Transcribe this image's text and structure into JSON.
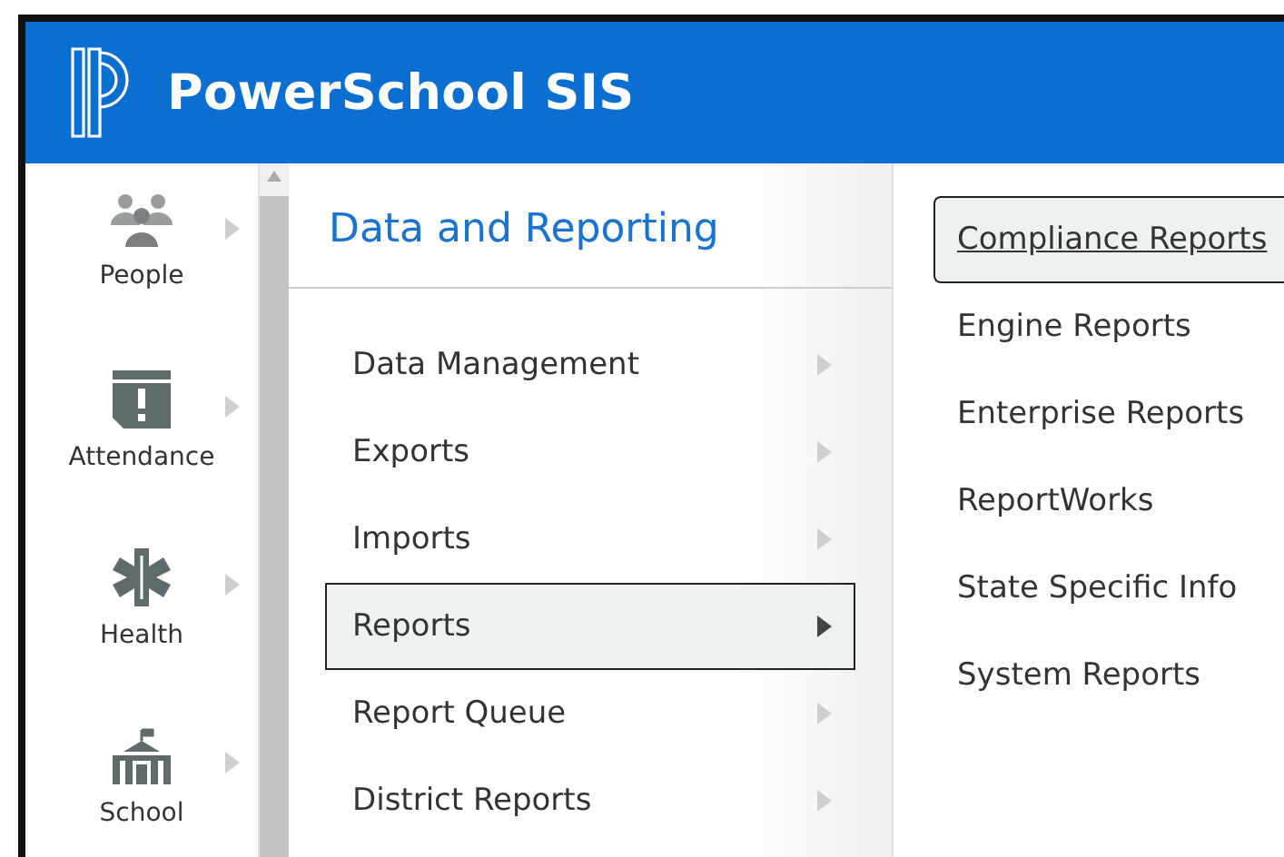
{
  "header": {
    "title": "PowerSchool SIS"
  },
  "sidebar": {
    "items": [
      {
        "label": "People",
        "selected": false
      },
      {
        "label": "Attendance",
        "selected": false
      },
      {
        "label": "Health",
        "selected": false
      },
      {
        "label": "School",
        "selected": false
      }
    ]
  },
  "menu": {
    "title": "Data and Reporting",
    "items": [
      {
        "label": "Data Management",
        "selected": false
      },
      {
        "label": "Exports",
        "selected": false
      },
      {
        "label": "Imports",
        "selected": false
      },
      {
        "label": "Reports",
        "selected": true
      },
      {
        "label": "Report Queue",
        "selected": false
      },
      {
        "label": "District Reports",
        "selected": false
      }
    ]
  },
  "submenu": {
    "items": [
      {
        "label": "Compliance Reports",
        "selected": true
      },
      {
        "label": "Engine Reports",
        "selected": false
      },
      {
        "label": "Enterprise Reports",
        "selected": false
      },
      {
        "label": "ReportWorks",
        "selected": false
      },
      {
        "label": "State Specific Info",
        "selected": false
      },
      {
        "label": "System Reports",
        "selected": false
      }
    ]
  }
}
